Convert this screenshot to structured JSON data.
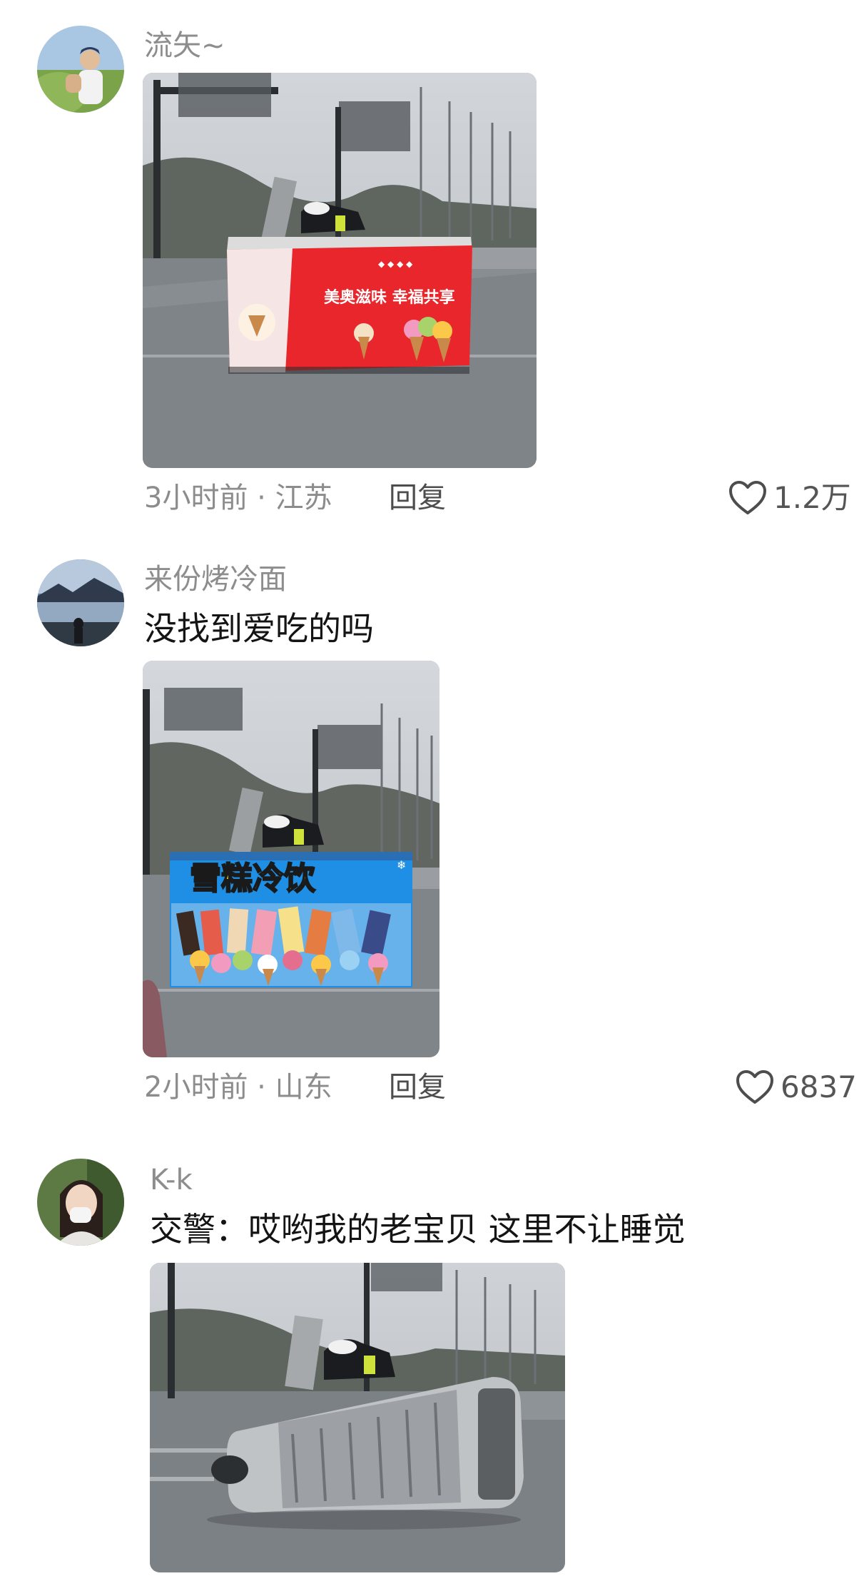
{
  "comments": [
    {
      "username": "流矢~",
      "text": "",
      "photo": {
        "banner": "美奥滋味 幸福共享",
        "sub": "◆ ◆ ◆ ◆",
        "accent": "#e8262b"
      },
      "time_location": "3小时前 · 江苏",
      "reply_label": "回复",
      "likes": "1.2万"
    },
    {
      "username": "来份烤冷面",
      "text": "没找到爱吃的吗",
      "photo": {
        "banner": "雪糕冷饮",
        "accent": "#1f8fe6"
      },
      "time_location": "2小时前 · 山东",
      "reply_label": "回复",
      "likes": "6837"
    },
    {
      "username": "K-k",
      "text": "交警：哎哟我的老宝贝 这里不让睡觉",
      "photo": {
        "accent": "#bfc3c6"
      },
      "time_location": "",
      "reply_label": "",
      "likes": ""
    }
  ],
  "icons": {
    "like": "heart-outline-icon"
  },
  "colors": {
    "username": "#8d8d8d",
    "text": "#141414",
    "meta": "#8c8c8c"
  }
}
